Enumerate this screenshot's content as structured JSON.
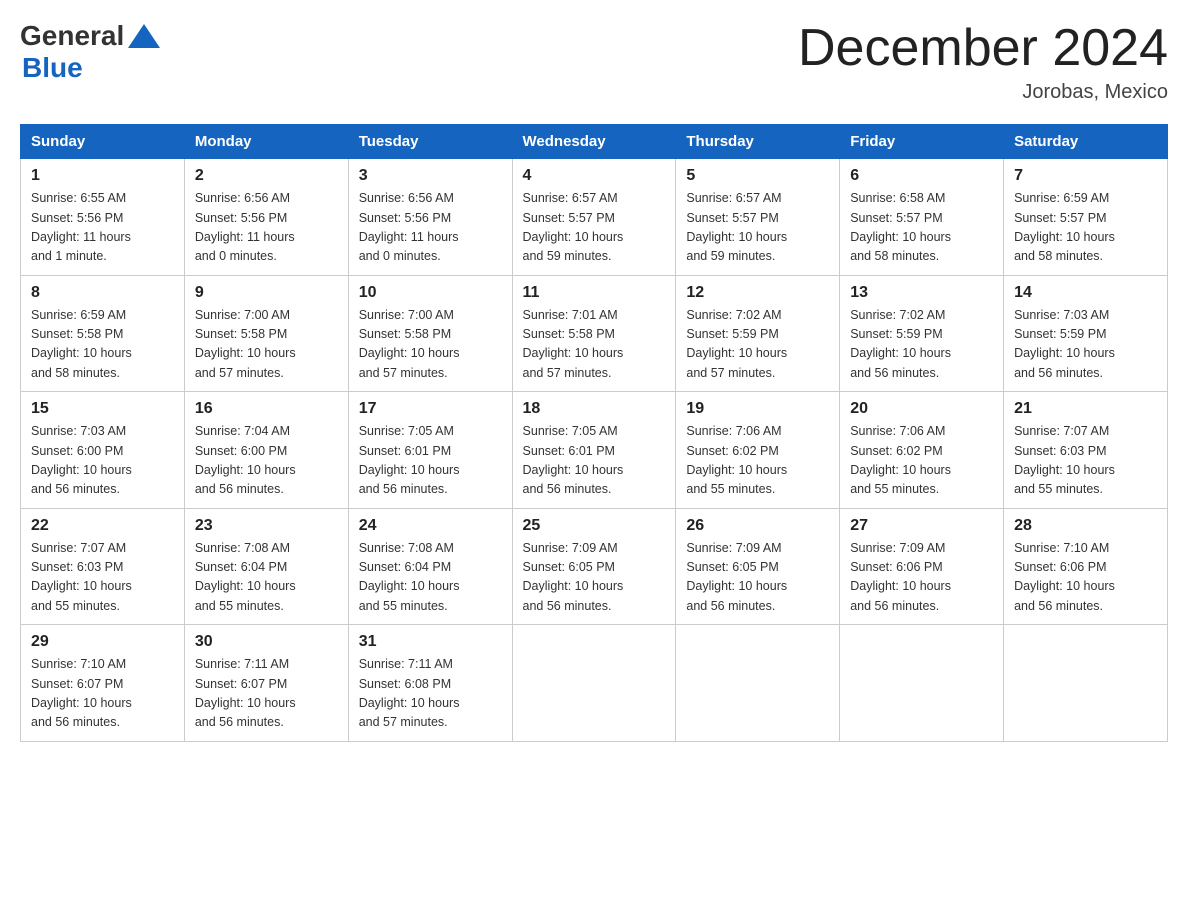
{
  "header": {
    "logo_general": "General",
    "logo_blue": "Blue",
    "title": "December 2024",
    "location": "Jorobas, Mexico"
  },
  "days_of_week": [
    "Sunday",
    "Monday",
    "Tuesday",
    "Wednesday",
    "Thursday",
    "Friday",
    "Saturday"
  ],
  "weeks": [
    [
      {
        "num": "1",
        "sunrise": "6:55 AM",
        "sunset": "5:56 PM",
        "daylight": "11 hours and 1 minute."
      },
      {
        "num": "2",
        "sunrise": "6:56 AM",
        "sunset": "5:56 PM",
        "daylight": "11 hours and 0 minutes."
      },
      {
        "num": "3",
        "sunrise": "6:56 AM",
        "sunset": "5:56 PM",
        "daylight": "11 hours and 0 minutes."
      },
      {
        "num": "4",
        "sunrise": "6:57 AM",
        "sunset": "5:57 PM",
        "daylight": "10 hours and 59 minutes."
      },
      {
        "num": "5",
        "sunrise": "6:57 AM",
        "sunset": "5:57 PM",
        "daylight": "10 hours and 59 minutes."
      },
      {
        "num": "6",
        "sunrise": "6:58 AM",
        "sunset": "5:57 PM",
        "daylight": "10 hours and 58 minutes."
      },
      {
        "num": "7",
        "sunrise": "6:59 AM",
        "sunset": "5:57 PM",
        "daylight": "10 hours and 58 minutes."
      }
    ],
    [
      {
        "num": "8",
        "sunrise": "6:59 AM",
        "sunset": "5:58 PM",
        "daylight": "10 hours and 58 minutes."
      },
      {
        "num": "9",
        "sunrise": "7:00 AM",
        "sunset": "5:58 PM",
        "daylight": "10 hours and 57 minutes."
      },
      {
        "num": "10",
        "sunrise": "7:00 AM",
        "sunset": "5:58 PM",
        "daylight": "10 hours and 57 minutes."
      },
      {
        "num": "11",
        "sunrise": "7:01 AM",
        "sunset": "5:58 PM",
        "daylight": "10 hours and 57 minutes."
      },
      {
        "num": "12",
        "sunrise": "7:02 AM",
        "sunset": "5:59 PM",
        "daylight": "10 hours and 57 minutes."
      },
      {
        "num": "13",
        "sunrise": "7:02 AM",
        "sunset": "5:59 PM",
        "daylight": "10 hours and 56 minutes."
      },
      {
        "num": "14",
        "sunrise": "7:03 AM",
        "sunset": "5:59 PM",
        "daylight": "10 hours and 56 minutes."
      }
    ],
    [
      {
        "num": "15",
        "sunrise": "7:03 AM",
        "sunset": "6:00 PM",
        "daylight": "10 hours and 56 minutes."
      },
      {
        "num": "16",
        "sunrise": "7:04 AM",
        "sunset": "6:00 PM",
        "daylight": "10 hours and 56 minutes."
      },
      {
        "num": "17",
        "sunrise": "7:05 AM",
        "sunset": "6:01 PM",
        "daylight": "10 hours and 56 minutes."
      },
      {
        "num": "18",
        "sunrise": "7:05 AM",
        "sunset": "6:01 PM",
        "daylight": "10 hours and 56 minutes."
      },
      {
        "num": "19",
        "sunrise": "7:06 AM",
        "sunset": "6:02 PM",
        "daylight": "10 hours and 55 minutes."
      },
      {
        "num": "20",
        "sunrise": "7:06 AM",
        "sunset": "6:02 PM",
        "daylight": "10 hours and 55 minutes."
      },
      {
        "num": "21",
        "sunrise": "7:07 AM",
        "sunset": "6:03 PM",
        "daylight": "10 hours and 55 minutes."
      }
    ],
    [
      {
        "num": "22",
        "sunrise": "7:07 AM",
        "sunset": "6:03 PM",
        "daylight": "10 hours and 55 minutes."
      },
      {
        "num": "23",
        "sunrise": "7:08 AM",
        "sunset": "6:04 PM",
        "daylight": "10 hours and 55 minutes."
      },
      {
        "num": "24",
        "sunrise": "7:08 AM",
        "sunset": "6:04 PM",
        "daylight": "10 hours and 55 minutes."
      },
      {
        "num": "25",
        "sunrise": "7:09 AM",
        "sunset": "6:05 PM",
        "daylight": "10 hours and 56 minutes."
      },
      {
        "num": "26",
        "sunrise": "7:09 AM",
        "sunset": "6:05 PM",
        "daylight": "10 hours and 56 minutes."
      },
      {
        "num": "27",
        "sunrise": "7:09 AM",
        "sunset": "6:06 PM",
        "daylight": "10 hours and 56 minutes."
      },
      {
        "num": "28",
        "sunrise": "7:10 AM",
        "sunset": "6:06 PM",
        "daylight": "10 hours and 56 minutes."
      }
    ],
    [
      {
        "num": "29",
        "sunrise": "7:10 AM",
        "sunset": "6:07 PM",
        "daylight": "10 hours and 56 minutes."
      },
      {
        "num": "30",
        "sunrise": "7:11 AM",
        "sunset": "6:07 PM",
        "daylight": "10 hours and 56 minutes."
      },
      {
        "num": "31",
        "sunrise": "7:11 AM",
        "sunset": "6:08 PM",
        "daylight": "10 hours and 57 minutes."
      },
      null,
      null,
      null,
      null
    ]
  ],
  "labels": {
    "sunrise": "Sunrise:",
    "sunset": "Sunset:",
    "daylight": "Daylight:"
  }
}
